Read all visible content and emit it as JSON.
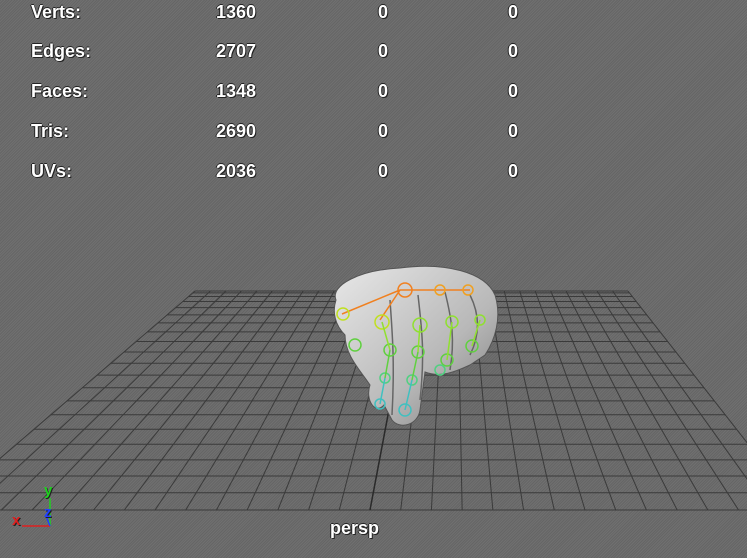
{
  "viewport": {
    "camera_name": "persp",
    "background_color": "#6b6b6b",
    "grid_color": "#3a3a3a"
  },
  "hud": {
    "stats": [
      {
        "label": "Verts:",
        "values": [
          "1360",
          "0",
          "0"
        ]
      },
      {
        "label": "Edges:",
        "values": [
          "2707",
          "0",
          "0"
        ]
      },
      {
        "label": "Faces:",
        "values": [
          "1348",
          "0",
          "0"
        ]
      },
      {
        "label": "Tris:",
        "values": [
          "2690",
          "0",
          "0"
        ]
      },
      {
        "label": "UVs:",
        "values": [
          "2036",
          "0",
          "0"
        ]
      }
    ]
  },
  "axis_gizmo": {
    "x": "x",
    "y": "y",
    "z": "z",
    "x_color": "#e02020",
    "y_color": "#20d020",
    "z_color": "#2040ff"
  },
  "scene": {
    "model": "hand-mesh",
    "joint_colors": [
      "#f08020",
      "#c0e020",
      "#60d040",
      "#40c0c0"
    ]
  }
}
